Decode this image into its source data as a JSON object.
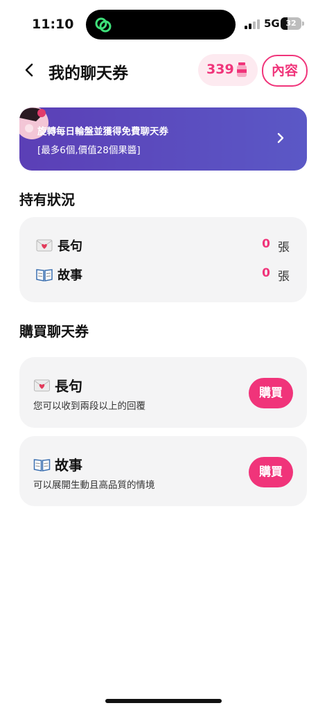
{
  "status_bar": {
    "time": "11:10",
    "network": "5G",
    "battery": "32",
    "battery_level": 0.32
  },
  "header": {
    "title": "我的聊天券",
    "balance": "339",
    "content_button": "內容"
  },
  "banner": {
    "line1": "旋轉每日輪盤並獲得免費聊天券",
    "line2": "[最多6個,價值28個果醬]"
  },
  "holdings": {
    "section_title": "持有狀況",
    "items": [
      {
        "label": "長句",
        "count": "0",
        "unit": "張",
        "icon": "love-letter-icon"
      },
      {
        "label": "故事",
        "count": "0",
        "unit": "張",
        "icon": "open-book-icon"
      }
    ]
  },
  "purchase": {
    "section_title": "購買聊天券",
    "items": [
      {
        "title": "長句",
        "desc": "您可以收到兩段以上的回覆",
        "button": "購買",
        "icon": "love-letter-icon"
      },
      {
        "title": "故事",
        "desc": "可以展開生動且高品質的情境",
        "button": "購買",
        "icon": "open-book-icon"
      }
    ]
  },
  "colors": {
    "accent": "#f0347a",
    "banner": "#5b48bd",
    "card": "#f4f4f5"
  }
}
